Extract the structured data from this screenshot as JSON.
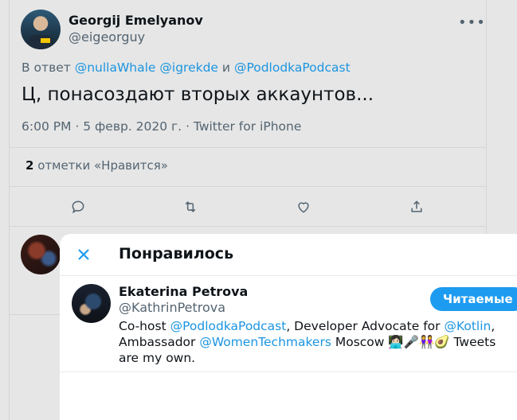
{
  "tweet": {
    "author_name": "Georgij Emelyanov",
    "author_handle": "@eigeorguy",
    "more_icon": "more-dots-icon",
    "reply_prefix": "В ответ",
    "reply_to_1": "@nullaWhale",
    "reply_to_2": "@igrekde",
    "reply_conj": "и",
    "reply_to_3": "@PodlodkaPodcast",
    "text": "Ц, понасоздают вторых аккаунтов...",
    "time": "6:00 PM",
    "date": "5 февр. 2020 г.",
    "source": "Twitter for iPhone",
    "likes_count": "2",
    "likes_label": "отметки «Нравится»"
  },
  "modal": {
    "title": "Понравилось",
    "user": {
      "name": "Ekaterina Petrova",
      "handle": "@KathrinPetrova",
      "follow_label": "Читаемые",
      "bio_1": "Co-host ",
      "bio_link_1": "@PodlodkaPodcast",
      "bio_2": ", Developer Advocate for ",
      "bio_link_2": "@Kotlin",
      "bio_3": ", Ambassador ",
      "bio_link_3": "@WomenTechmakers",
      "bio_4": " Moscow 👩🏻‍💻🎤👭🥑 Tweets are my own."
    }
  },
  "colors": {
    "accent": "#1d9bf0",
    "link": "#1b95e0",
    "muted": "#536471",
    "dim_background": "#e6e6e6"
  }
}
